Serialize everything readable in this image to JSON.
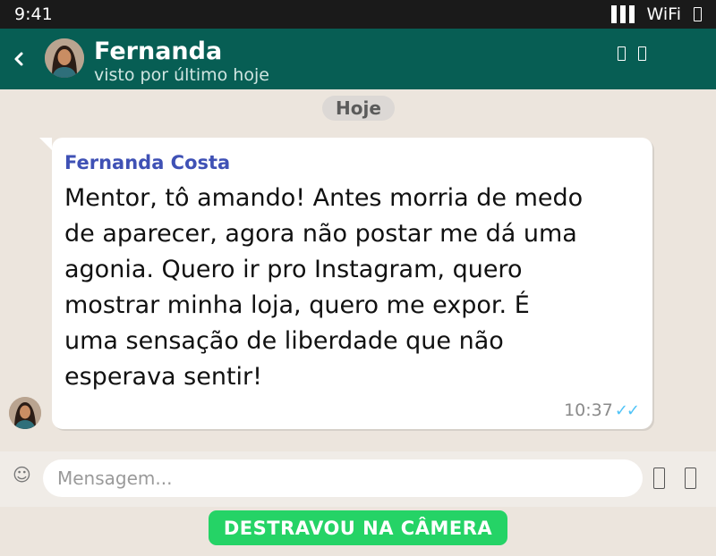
{
  "status_bar": {
    "time": "9:41",
    "wifi_label": "WiFi",
    "icons": [
      "signal-icon",
      "battery-icon"
    ]
  },
  "header": {
    "back_icon": "chevron-left-icon",
    "contact_name": "Fernanda",
    "last_seen": "visto por último hoje",
    "actions": [
      "video-call-icon",
      "phone-call-icon"
    ]
  },
  "date_chip": "Hoje",
  "message": {
    "sender": "Fernanda Costa",
    "text": "Mentor, tô amando! Antes morria de medo\nde aparecer, agora não postar me dá uma\nagonia. Quero ir pro Instagram, quero\nmostrar minha loja, quero me expor. É\numa sensação de liberdade que não\nesperava sentir!",
    "time": "10:37",
    "ticks": "✓✓"
  },
  "composer": {
    "emoji_icon": "emoji-icon",
    "placeholder": "Mensagem...",
    "icons": [
      "attach-icon",
      "camera-icon"
    ]
  },
  "cta": {
    "label": "DESTRAVOU NA CÂMERA"
  },
  "colors": {
    "header": "#075e54",
    "background": "#ece5dd",
    "sender_name": "#3f51b5",
    "read_ticks": "#4fc3f7",
    "cta": "#25d366"
  }
}
